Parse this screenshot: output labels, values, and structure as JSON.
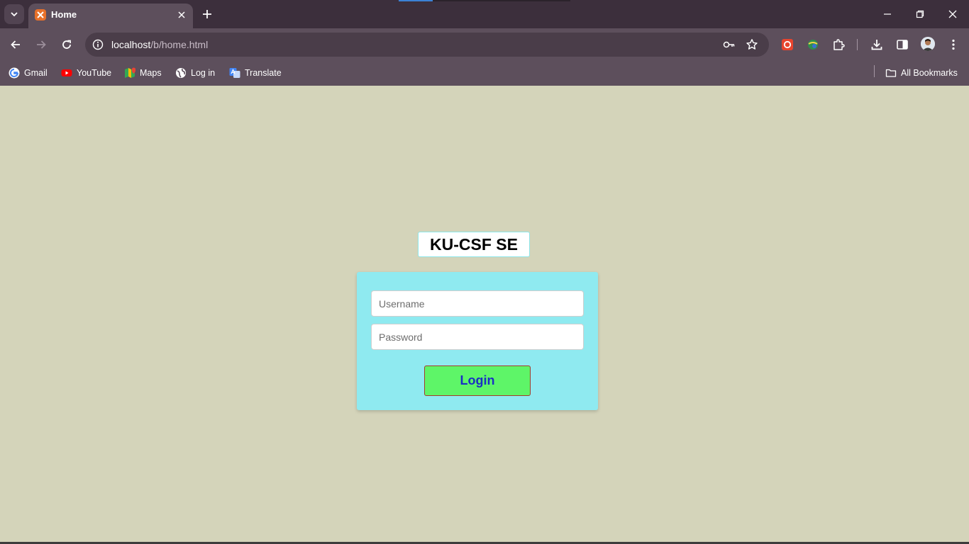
{
  "browser": {
    "tab": {
      "title": "Home"
    },
    "address_bar": {
      "host": "localhost",
      "path": "/b/home.html"
    },
    "bookmarks": [
      {
        "label": "Gmail",
        "icon": "google-icon"
      },
      {
        "label": "YouTube",
        "icon": "youtube-icon"
      },
      {
        "label": "Maps",
        "icon": "maps-icon"
      },
      {
        "label": "Log in",
        "icon": "globe-icon"
      },
      {
        "label": "Translate",
        "icon": "translate-icon"
      }
    ],
    "all_bookmarks_label": "All Bookmarks"
  },
  "page": {
    "heading": "KU-CSF SE",
    "username_placeholder": "Username",
    "password_placeholder": "Password",
    "login_label": "Login",
    "colors": {
      "background": "#d4d4ba",
      "panel": "#8feaf0",
      "button": "#5ef568",
      "button_text": "#1a2fc4"
    }
  }
}
